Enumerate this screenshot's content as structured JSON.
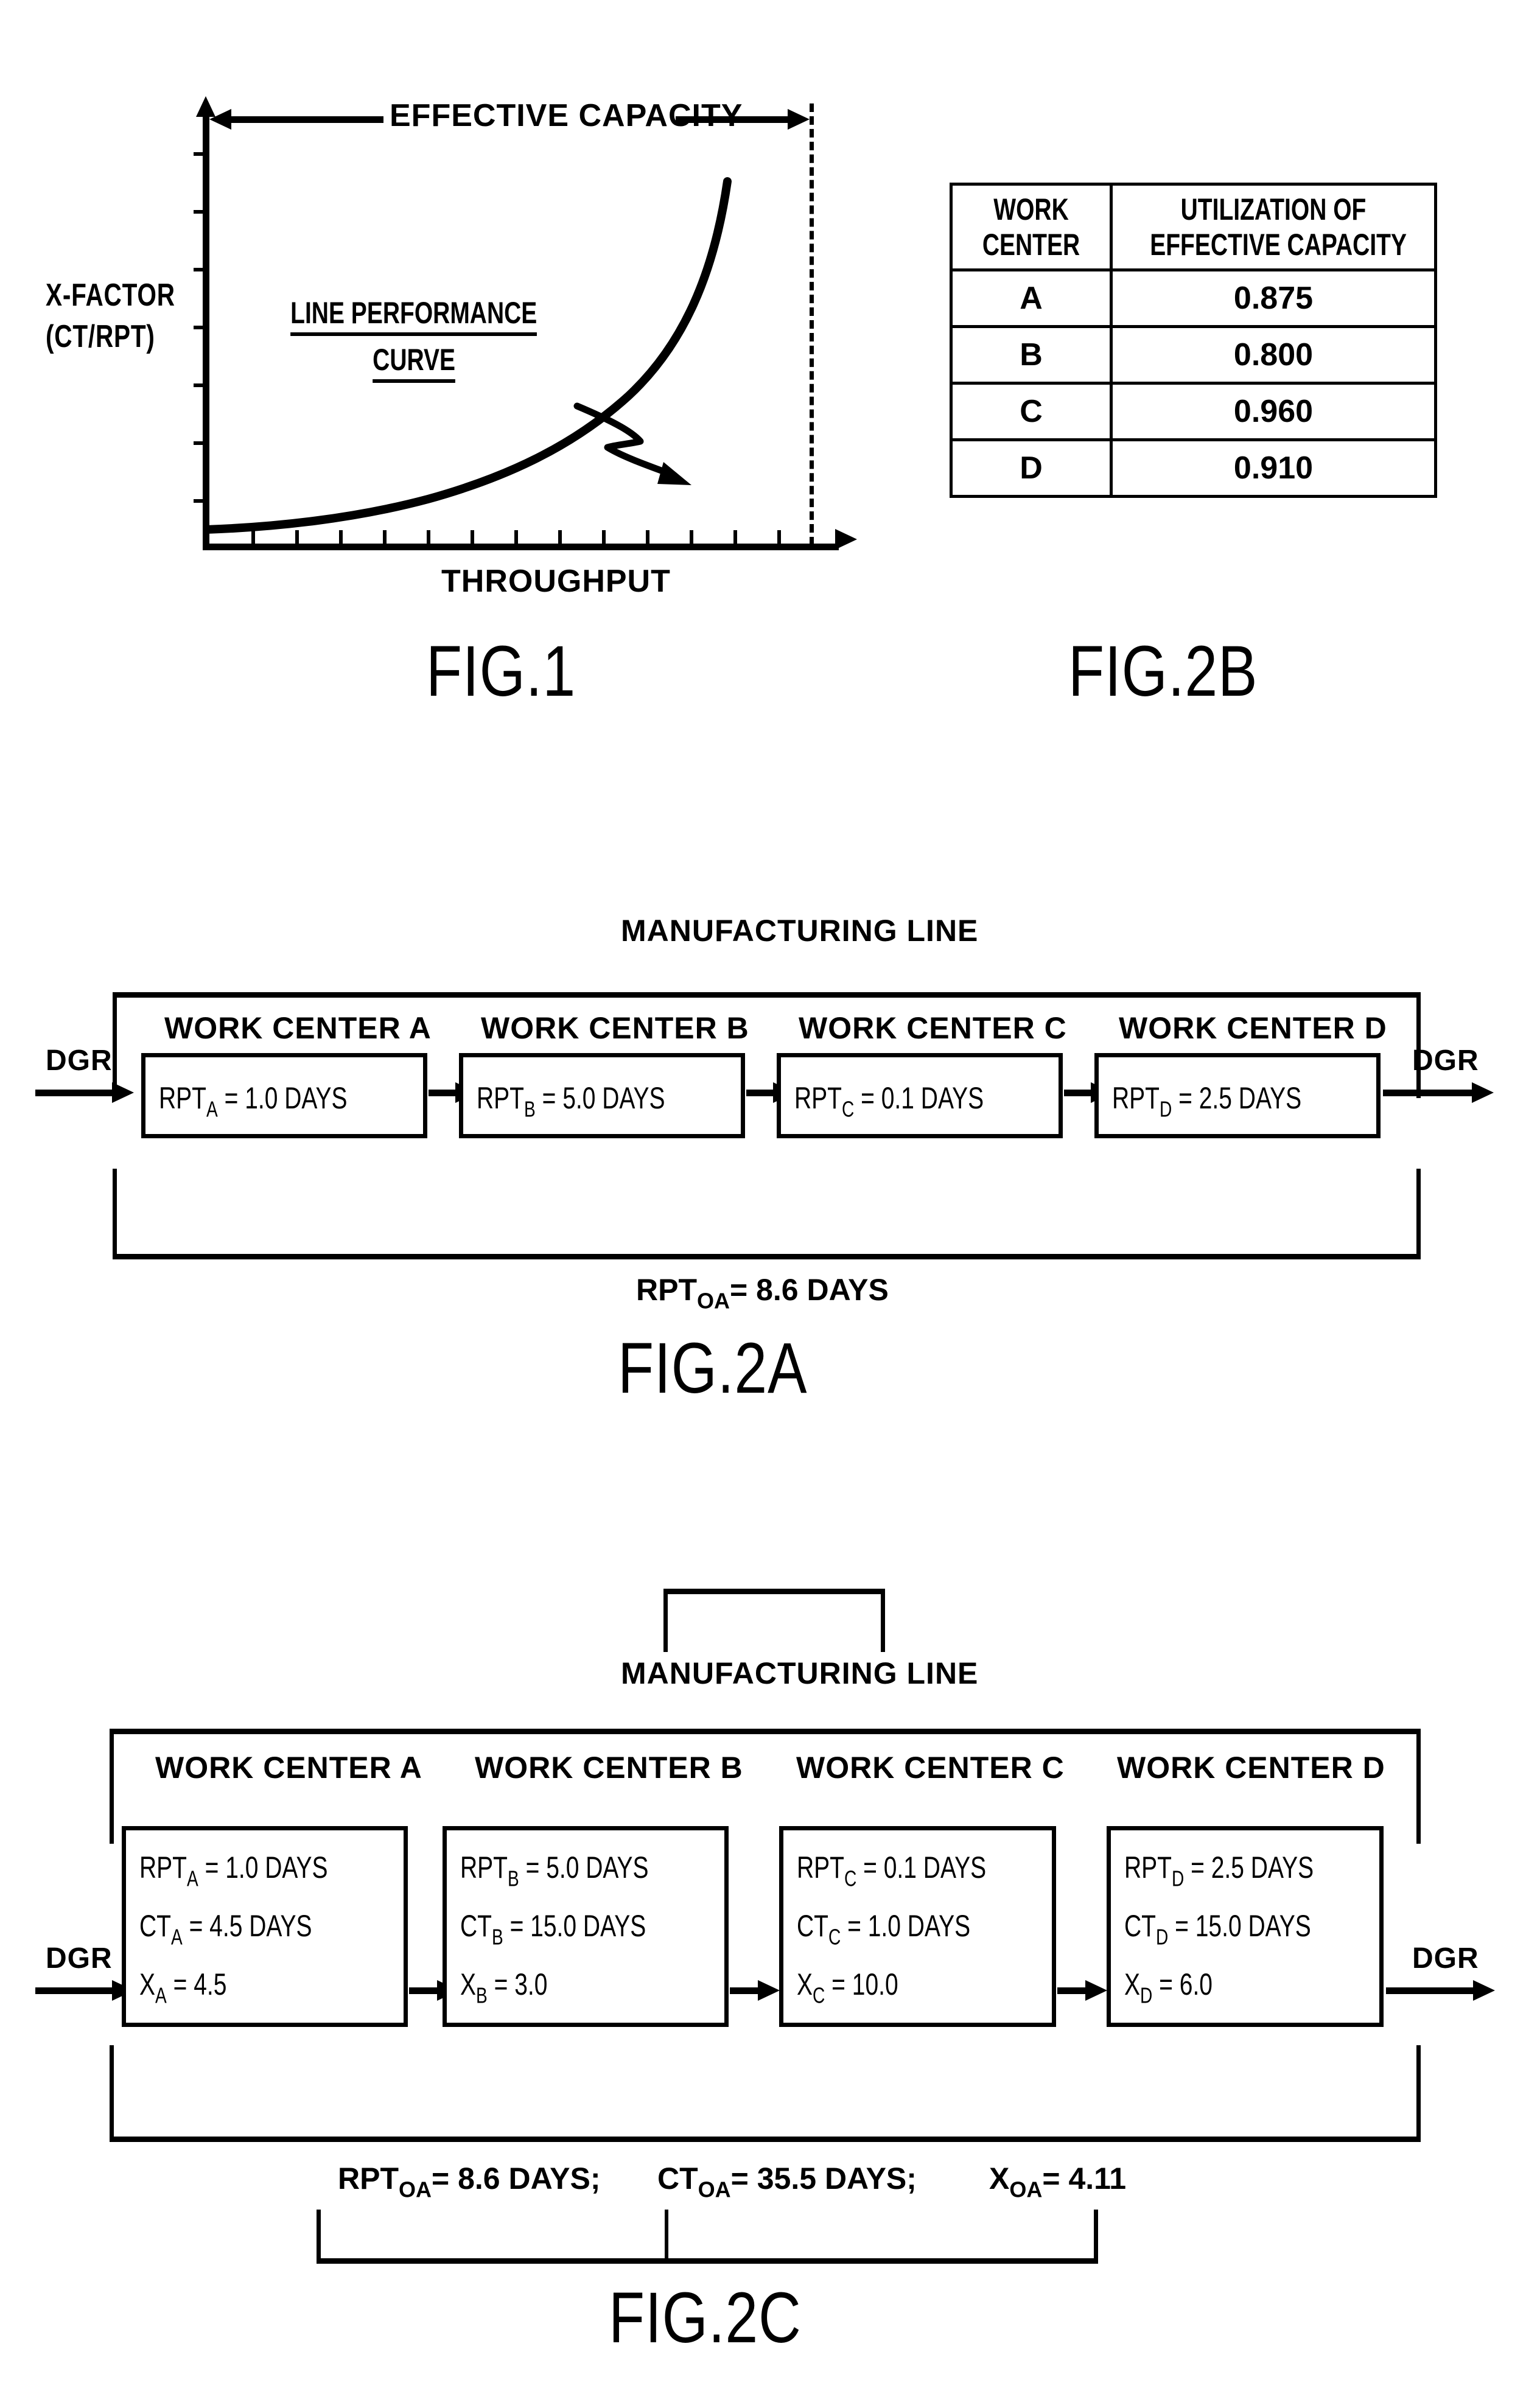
{
  "figures": {
    "fig1": {
      "label": "FIG.1",
      "capacity_label": "EFFECTIVE CAPACITY",
      "y_axis_label_line1": "X-FACTOR",
      "y_axis_label_line2": "(CT/RPT)",
      "x_axis_label": "THROUGHPUT",
      "annotation_line1": "LINE PERFORMANCE",
      "annotation_line2": "CURVE"
    },
    "fig2a": {
      "label": "FIG.2A",
      "title": "MANUFACTURING LINE",
      "input_label": "DGR",
      "output_label": "DGR",
      "summary": "RPT",
      "summary_sub": "OA",
      "summary_rest": "= 8.6 DAYS",
      "stations": [
        {
          "title": "WORK CENTER A",
          "metric": "RPT",
          "sub": "A",
          "value": "= 1.0 DAYS"
        },
        {
          "title": "WORK CENTER B",
          "metric": "RPT",
          "sub": "B",
          "value": "= 5.0 DAYS"
        },
        {
          "title": "WORK CENTER C",
          "metric": "RPT",
          "sub": "C",
          "value": "= 0.1 DAYS"
        },
        {
          "title": "WORK CENTER D",
          "metric": "RPT",
          "sub": "D",
          "value": "= 2.5 DAYS"
        }
      ]
    },
    "fig2b": {
      "label": "FIG.2B",
      "columns": [
        "WORK CENTER",
        "UTILIZATION OF EFFECTIVE CAPACITY"
      ],
      "column1_line1": "WORK",
      "column1_line2": "CENTER",
      "column2_line1": "UTILIZATION OF",
      "column2_line2": "EFFECTIVE CAPACITY",
      "rows": [
        {
          "work_center": "A",
          "utilization": "0.875"
        },
        {
          "work_center": "B",
          "utilization": "0.800"
        },
        {
          "work_center": "C",
          "utilization": "0.960"
        },
        {
          "work_center": "D",
          "utilization": "0.910"
        }
      ]
    },
    "fig2c": {
      "label": "FIG.2C",
      "title": "MANUFACTURING LINE",
      "input_label": "DGR",
      "output_label": "DGR",
      "summary_parts": [
        {
          "metric": "RPT",
          "sub": "OA",
          "value": "= 8.6 DAYS;"
        },
        {
          "metric": "CT",
          "sub": "OA",
          "value": "= 35.5 DAYS;"
        },
        {
          "metric": "X",
          "sub": "OA",
          "value": "= 4.11"
        }
      ],
      "stations": [
        {
          "title": "WORK CENTER A",
          "lines": [
            {
              "metric": "RPT",
              "sub": "A",
              "value": "= 1.0 DAYS"
            },
            {
              "metric": "CT",
              "sub": "A",
              "value": "= 4.5 DAYS"
            },
            {
              "metric": "X",
              "sub": "A",
              "value": "= 4.5"
            }
          ]
        },
        {
          "title": "WORK CENTER B",
          "lines": [
            {
              "metric": "RPT",
              "sub": "B",
              "value": "= 5.0 DAYS"
            },
            {
              "metric": "CT",
              "sub": "B",
              "value": "= 15.0 DAYS"
            },
            {
              "metric": "X",
              "sub": "B",
              "value": "= 3.0"
            }
          ]
        },
        {
          "title": "WORK CENTER C",
          "lines": [
            {
              "metric": "RPT",
              "sub": "C",
              "value": "= 0.1 DAYS"
            },
            {
              "metric": "CT",
              "sub": "C",
              "value": "= 1.0 DAYS"
            },
            {
              "metric": "X",
              "sub": "C",
              "value": "= 10.0"
            }
          ]
        },
        {
          "title": "WORK CENTER D",
          "lines": [
            {
              "metric": "RPT",
              "sub": "D",
              "value": "= 2.5 DAYS"
            },
            {
              "metric": "CT",
              "sub": "D",
              "value": "= 15.0 DAYS"
            },
            {
              "metric": "X",
              "sub": "D",
              "value": "= 6.0"
            }
          ]
        }
      ]
    }
  },
  "chart_data": {
    "type": "line",
    "title": "FIG.1 Line Performance Curve",
    "xlabel": "THROUGHPUT",
    "ylabel": "X-FACTOR (CT/RPT)",
    "xlim": [
      0,
      1
    ],
    "ylim": [
      0,
      1
    ],
    "grid": false,
    "legend": null,
    "annotations": [
      "EFFECTIVE CAPACITY",
      "LINE PERFORMANCE CURVE"
    ],
    "x_tick_count": 14,
    "y_tick_count": 7,
    "asymptote_x": 1.0,
    "series": [
      {
        "name": "LINE PERFORMANCE CURVE",
        "x": [
          0.0,
          0.1,
          0.2,
          0.3,
          0.4,
          0.5,
          0.6,
          0.68,
          0.75,
          0.82,
          0.88,
          0.92,
          0.95,
          0.965,
          0.975
        ],
        "y": [
          0.055,
          0.06,
          0.068,
          0.08,
          0.098,
          0.125,
          0.168,
          0.215,
          0.285,
          0.4,
          0.54,
          0.66,
          0.79,
          0.87,
          0.935
        ]
      }
    ]
  }
}
